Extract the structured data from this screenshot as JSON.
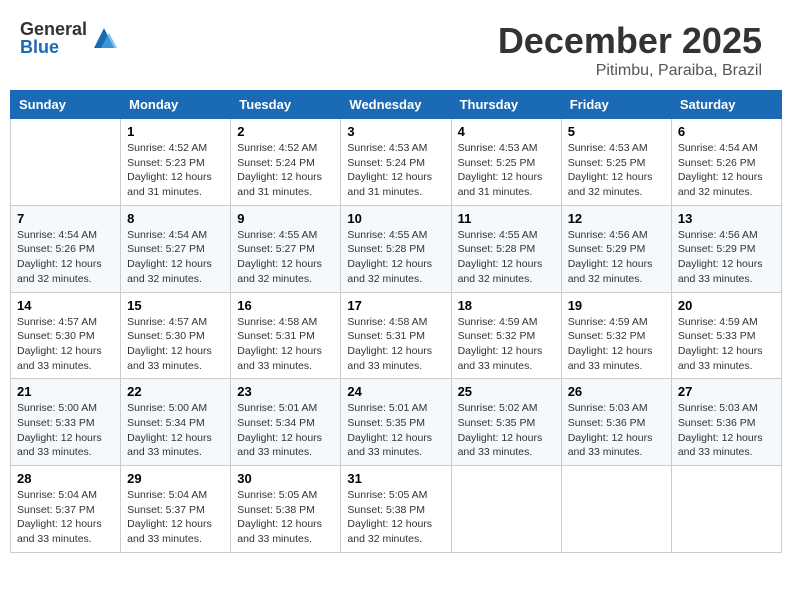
{
  "header": {
    "logo_general": "General",
    "logo_blue": "Blue",
    "month": "December 2025",
    "location": "Pitimbu, Paraiba, Brazil"
  },
  "days_of_week": [
    "Sunday",
    "Monday",
    "Tuesday",
    "Wednesday",
    "Thursday",
    "Friday",
    "Saturday"
  ],
  "weeks": [
    [
      {
        "day": "",
        "info": ""
      },
      {
        "day": "1",
        "info": "Sunrise: 4:52 AM\nSunset: 5:23 PM\nDaylight: 12 hours\nand 31 minutes."
      },
      {
        "day": "2",
        "info": "Sunrise: 4:52 AM\nSunset: 5:24 PM\nDaylight: 12 hours\nand 31 minutes."
      },
      {
        "day": "3",
        "info": "Sunrise: 4:53 AM\nSunset: 5:24 PM\nDaylight: 12 hours\nand 31 minutes."
      },
      {
        "day": "4",
        "info": "Sunrise: 4:53 AM\nSunset: 5:25 PM\nDaylight: 12 hours\nand 31 minutes."
      },
      {
        "day": "5",
        "info": "Sunrise: 4:53 AM\nSunset: 5:25 PM\nDaylight: 12 hours\nand 32 minutes."
      },
      {
        "day": "6",
        "info": "Sunrise: 4:54 AM\nSunset: 5:26 PM\nDaylight: 12 hours\nand 32 minutes."
      }
    ],
    [
      {
        "day": "7",
        "info": "Sunrise: 4:54 AM\nSunset: 5:26 PM\nDaylight: 12 hours\nand 32 minutes."
      },
      {
        "day": "8",
        "info": "Sunrise: 4:54 AM\nSunset: 5:27 PM\nDaylight: 12 hours\nand 32 minutes."
      },
      {
        "day": "9",
        "info": "Sunrise: 4:55 AM\nSunset: 5:27 PM\nDaylight: 12 hours\nand 32 minutes."
      },
      {
        "day": "10",
        "info": "Sunrise: 4:55 AM\nSunset: 5:28 PM\nDaylight: 12 hours\nand 32 minutes."
      },
      {
        "day": "11",
        "info": "Sunrise: 4:55 AM\nSunset: 5:28 PM\nDaylight: 12 hours\nand 32 minutes."
      },
      {
        "day": "12",
        "info": "Sunrise: 4:56 AM\nSunset: 5:29 PM\nDaylight: 12 hours\nand 32 minutes."
      },
      {
        "day": "13",
        "info": "Sunrise: 4:56 AM\nSunset: 5:29 PM\nDaylight: 12 hours\nand 33 minutes."
      }
    ],
    [
      {
        "day": "14",
        "info": "Sunrise: 4:57 AM\nSunset: 5:30 PM\nDaylight: 12 hours\nand 33 minutes."
      },
      {
        "day": "15",
        "info": "Sunrise: 4:57 AM\nSunset: 5:30 PM\nDaylight: 12 hours\nand 33 minutes."
      },
      {
        "day": "16",
        "info": "Sunrise: 4:58 AM\nSunset: 5:31 PM\nDaylight: 12 hours\nand 33 minutes."
      },
      {
        "day": "17",
        "info": "Sunrise: 4:58 AM\nSunset: 5:31 PM\nDaylight: 12 hours\nand 33 minutes."
      },
      {
        "day": "18",
        "info": "Sunrise: 4:59 AM\nSunset: 5:32 PM\nDaylight: 12 hours\nand 33 minutes."
      },
      {
        "day": "19",
        "info": "Sunrise: 4:59 AM\nSunset: 5:32 PM\nDaylight: 12 hours\nand 33 minutes."
      },
      {
        "day": "20",
        "info": "Sunrise: 4:59 AM\nSunset: 5:33 PM\nDaylight: 12 hours\nand 33 minutes."
      }
    ],
    [
      {
        "day": "21",
        "info": "Sunrise: 5:00 AM\nSunset: 5:33 PM\nDaylight: 12 hours\nand 33 minutes."
      },
      {
        "day": "22",
        "info": "Sunrise: 5:00 AM\nSunset: 5:34 PM\nDaylight: 12 hours\nand 33 minutes."
      },
      {
        "day": "23",
        "info": "Sunrise: 5:01 AM\nSunset: 5:34 PM\nDaylight: 12 hours\nand 33 minutes."
      },
      {
        "day": "24",
        "info": "Sunrise: 5:01 AM\nSunset: 5:35 PM\nDaylight: 12 hours\nand 33 minutes."
      },
      {
        "day": "25",
        "info": "Sunrise: 5:02 AM\nSunset: 5:35 PM\nDaylight: 12 hours\nand 33 minutes."
      },
      {
        "day": "26",
        "info": "Sunrise: 5:03 AM\nSunset: 5:36 PM\nDaylight: 12 hours\nand 33 minutes."
      },
      {
        "day": "27",
        "info": "Sunrise: 5:03 AM\nSunset: 5:36 PM\nDaylight: 12 hours\nand 33 minutes."
      }
    ],
    [
      {
        "day": "28",
        "info": "Sunrise: 5:04 AM\nSunset: 5:37 PM\nDaylight: 12 hours\nand 33 minutes."
      },
      {
        "day": "29",
        "info": "Sunrise: 5:04 AM\nSunset: 5:37 PM\nDaylight: 12 hours\nand 33 minutes."
      },
      {
        "day": "30",
        "info": "Sunrise: 5:05 AM\nSunset: 5:38 PM\nDaylight: 12 hours\nand 33 minutes."
      },
      {
        "day": "31",
        "info": "Sunrise: 5:05 AM\nSunset: 5:38 PM\nDaylight: 12 hours\nand 32 minutes."
      },
      {
        "day": "",
        "info": ""
      },
      {
        "day": "",
        "info": ""
      },
      {
        "day": "",
        "info": ""
      }
    ]
  ]
}
